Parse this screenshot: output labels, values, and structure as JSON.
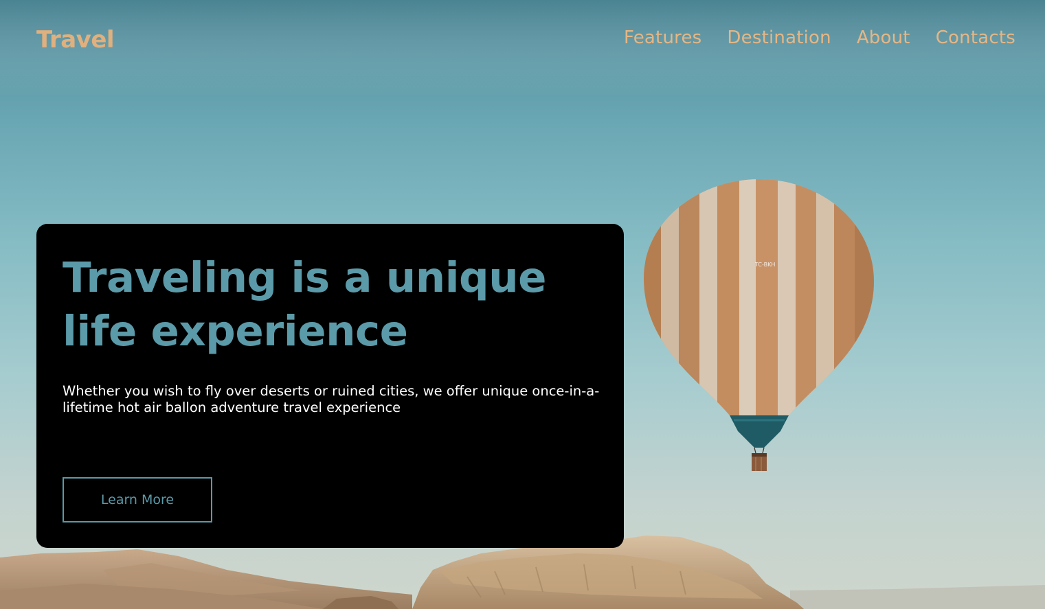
{
  "brand": {
    "logo": "Travel",
    "accent_color": "#e0b07e"
  },
  "nav": {
    "items": [
      "Features",
      "Destination",
      "About",
      "Contacts"
    ]
  },
  "hero": {
    "title": "Traveling is a unique life experience",
    "description": "Whether you wish to fly over deserts or ruined cities, we offer unique once-in-a-lifetime hot air ballon adventure travel experience",
    "cta_label": "Learn More",
    "title_color": "#5b9aa9",
    "card_color": "#000000",
    "balloon_marking": "TC-BKH"
  },
  "background": {
    "image": "hot-air-balloon-over-desert"
  }
}
